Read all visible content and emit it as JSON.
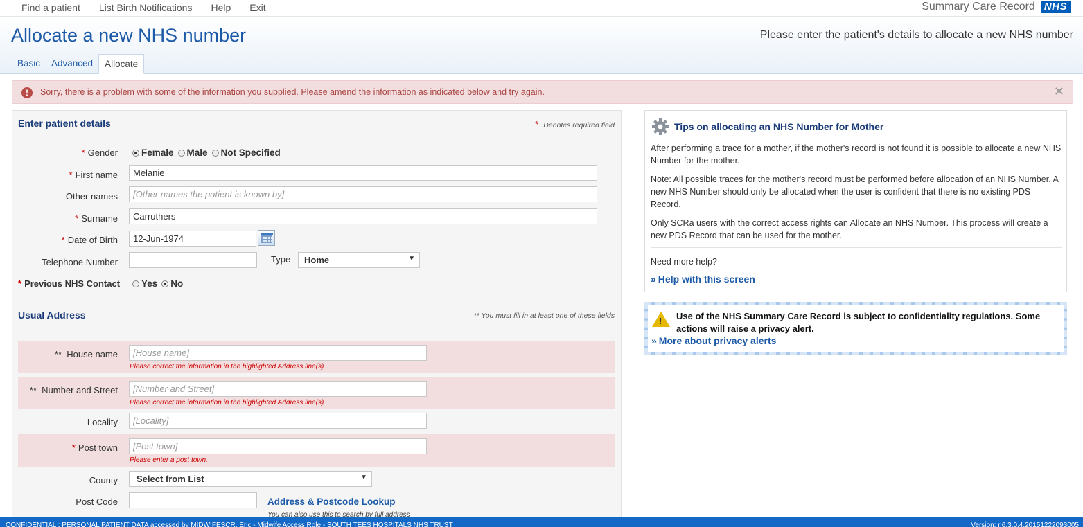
{
  "topnav": {
    "links": [
      "Find a patient",
      "List Birth Notifications",
      "Help",
      "Exit"
    ],
    "brand_text": "Summary Care Record",
    "logo_text": "NHS"
  },
  "header": {
    "title": "Allocate a new NHS number",
    "subtitle": "Please enter the patient's details to allocate a new NHS number",
    "tabs": [
      "Basic",
      "Advanced",
      "Allocate"
    ],
    "active_tab": "Allocate"
  },
  "error_banner": {
    "icon": "exclamation-icon",
    "text": "Sorry, there is a problem with some of the information you supplied. Please amend the information as indicated below and try again.",
    "close": "✕"
  },
  "patient_details": {
    "title": "Enter patient details",
    "required_mark": "*",
    "required_note": "Denotes required field",
    "gender": {
      "label": "Gender",
      "options": [
        "Female",
        "Male",
        "Not Specified"
      ],
      "selected": "Female"
    },
    "first_name": {
      "label": "First name",
      "value": "Melanie"
    },
    "other_names": {
      "label": "Other names",
      "placeholder": "[Other names the patient is known by]"
    },
    "surname": {
      "label": "Surname",
      "value": "Carruthers"
    },
    "dob": {
      "label": "Date of Birth",
      "value": "12-Jun-1974"
    },
    "telephone": {
      "label": "Telephone Number",
      "value": "",
      "type_label": "Type",
      "type_value": "Home"
    },
    "previous_contact": {
      "label": "Previous NHS Contact",
      "options": [
        "Yes",
        "No"
      ],
      "selected": "No"
    }
  },
  "address": {
    "title": "Usual Address",
    "note": "** You must fill in at least one of these fields",
    "double_mark": "**",
    "house_name": {
      "label": "House name",
      "placeholder": "[House name]",
      "error": "Please correct the information in the highlighted Address line(s)"
    },
    "number_street": {
      "label": "Number and Street",
      "placeholder": "[Number and Street]",
      "error": "Please correct the information in the highlighted Address line(s)"
    },
    "locality": {
      "label": "Locality",
      "placeholder": "[Locality]"
    },
    "post_town": {
      "label": "Post town",
      "placeholder": "[Post town]",
      "error": "Please enter a post town."
    },
    "county": {
      "label": "County",
      "value": "Select from List"
    },
    "post_code": {
      "label": "Post Code",
      "value": "",
      "lookup_link": "Address & Postcode Lookup",
      "lookup_hint": "You can also use this to search by full address"
    }
  },
  "tips": {
    "icon": "gear-icon",
    "title": "Tips on allocating an NHS Number for Mother",
    "paragraphs": [
      "After performing a trace for a mother, if the mother's record is not found it is possible to allocate a new NHS Number for the mother.",
      "Note: All possible traces for the mother's record must be performed before allocation of an NHS Number. A new NHS Number should only be allocated when the user is confident that there is no existing PDS Record.",
      "Only SCRa users with the correct access rights can Allocate an NHS Number. This process will create a new PDS Record that can be used for the mother."
    ],
    "need_help": "Need more help?",
    "help_link": "Help with this screen"
  },
  "privacy": {
    "icon": "warning-icon",
    "text": "Use of the NHS Summary Care Record is subject to confidentiality regulations. Some actions will raise a privacy alert.",
    "link": "More about privacy alerts"
  },
  "footer": {
    "left": "CONFIDENTIAL : PERSONAL PATIENT DATA accessed by MIDWIFESCR, Eric - Midwife Access Role - SOUTH TEES HOSPITALS NHS TRUST",
    "right": "Version: r.6.3.0.4.20151222093005"
  },
  "colors": {
    "brand_blue": "#1c5aa8",
    "error_bg": "#f2dede",
    "error_text": "#a94442",
    "footer_bg": "#1468c6"
  }
}
